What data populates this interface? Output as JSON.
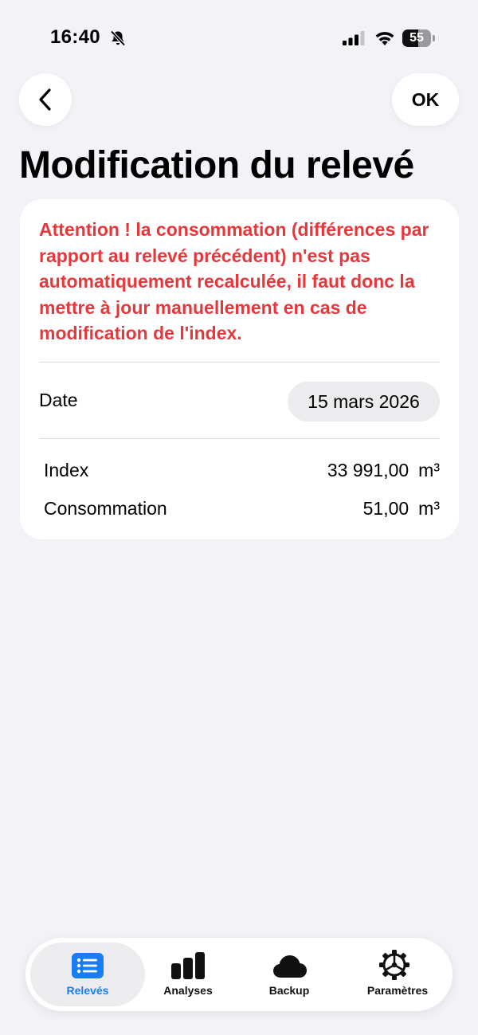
{
  "status_bar": {
    "time": "16:40",
    "battery": "55",
    "battery_level": 0.55
  },
  "nav": {
    "ok_label": "OK"
  },
  "page": {
    "title": "Modification du relevé"
  },
  "card": {
    "warning": "Attention ! la consommation (différences par rapport au relevé précédent) n'est pas automatiquement recalculée, il faut donc la mettre à jour manuellement en cas de modification de l'index.",
    "date_label": "Date",
    "date_value": "15 mars 2026",
    "rows": [
      {
        "label": "Index",
        "value": "33 991,00",
        "unit": "m³"
      },
      {
        "label": "Consommation",
        "value": "51,00",
        "unit": "m³"
      }
    ]
  },
  "tabbar": {
    "tabs": [
      {
        "label": "Relevés",
        "icon": "list-icon",
        "active": true
      },
      {
        "label": "Analyses",
        "icon": "bar-chart-icon",
        "active": false
      },
      {
        "label": "Backup",
        "icon": "cloud-icon",
        "active": false
      },
      {
        "label": "Paramètres",
        "icon": "gear-icon",
        "active": false
      }
    ]
  },
  "colors": {
    "warning": "#e8373b",
    "accent": "#1a7cf2",
    "background": "#f2f2f7"
  }
}
